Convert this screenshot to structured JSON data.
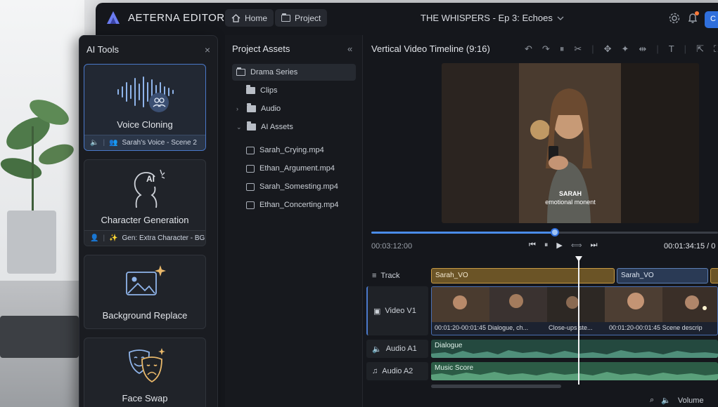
{
  "app": {
    "logo_text": "AETERNA EDITOR",
    "home_label": "Home",
    "project_label": "Project",
    "project_title": "THE WHISPERS - Ep 3: Echoes",
    "share_label": "C"
  },
  "ai_tools": {
    "title": "AI Tools",
    "close": "×",
    "cards": [
      {
        "label": "Voice Cloning",
        "sub": "Sarah's Voice - Scene 2"
      },
      {
        "label": "Character Generation",
        "sub": "Gen: Extra Character - BG"
      },
      {
        "label": "Background Replace"
      },
      {
        "label": "Face Swap"
      }
    ],
    "ai_glyph": "AI"
  },
  "assets": {
    "title": "Project Assets",
    "collapse": "«",
    "tree": [
      {
        "label": "Drama Series"
      },
      {
        "label": "Clips"
      },
      {
        "label": "Audio"
      },
      {
        "label": "AI Assets"
      }
    ],
    "files": [
      "Sarah_Crying.mp4",
      "Ethan_Argument.mp4",
      "Sarah_Somesting.mp4",
      "Ethan_Concerting.mp4"
    ]
  },
  "timeline": {
    "title": "Vertical Video Timeline (9:16)",
    "preview_caption_name": "SARAH",
    "preview_caption_text": "emotional monent",
    "time_current": "00:03:12:00",
    "time_total": "00:01:34:15 / 0",
    "progress_fraction": 0.53,
    "tracks": {
      "track_label": "Track",
      "video_label": "Video V1",
      "audio1_label": "Audio A1",
      "audio2_label": "Audio A2"
    },
    "vo_clips": [
      "Sarah_VO",
      "Sarah_VO"
    ],
    "video_segments": [
      "00:01:20-00:01:45  Dialogue, ch...",
      "Close-ups ste...",
      "00:01:20-00:01:45  Scene descrip"
    ],
    "audio1_clip": "Dialogue",
    "audio2_clip": "Music Score",
    "volume_label": "Volume"
  },
  "colors": {
    "accent_blue": "#2f6fdc",
    "vo_gold": "#c79a44",
    "audio_teal": "#2f6b55",
    "music_green": "#3f7c5d"
  }
}
